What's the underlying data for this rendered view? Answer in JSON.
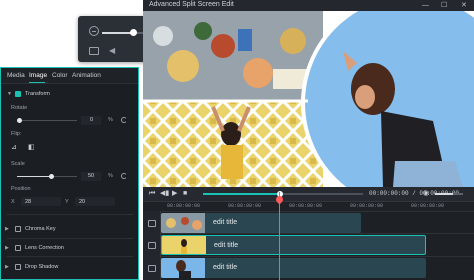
{
  "window": {
    "title": "Advanced Split Screen Edit",
    "minimize": "—",
    "maximize": "☐",
    "close": "✕"
  },
  "popup": {
    "volume_level": 0.68
  },
  "panel": {
    "tabs": [
      {
        "label": "Media"
      },
      {
        "label": "Image"
      },
      {
        "label": "Color"
      },
      {
        "label": "Animation"
      }
    ],
    "transform": {
      "label": "Transform",
      "rotate_label": "Rotate",
      "rotate_value": "0",
      "rotate_unit": "%",
      "flip_label": "Flip:",
      "scale_label": "Scale",
      "scale_value": "50",
      "scale_unit": "%",
      "position_label": "Position",
      "x_label": "X",
      "x_value": "28",
      "y_label": "Y",
      "y_value": "20"
    },
    "sections": [
      {
        "label": "Chroma Key"
      },
      {
        "label": "Lens Correction"
      },
      {
        "label": "Drop Shadow"
      }
    ]
  },
  "playbar": {
    "progress": 0.49,
    "timecode": "00:00:00:00 / 00:00:00:00"
  },
  "timeline": {
    "ruler": [
      "00:00:00:00",
      "00:00:00:00",
      "00:00:00:00",
      "00:00:00:00",
      "00:00:00:00"
    ],
    "tracks": [
      {
        "label": "edit title"
      },
      {
        "label": "edit title"
      },
      {
        "label": "edit title"
      }
    ]
  },
  "colors": {
    "accent": "#19c3b4",
    "playhead": "#ff5a5a",
    "panel_bg": "#1b1f24"
  }
}
